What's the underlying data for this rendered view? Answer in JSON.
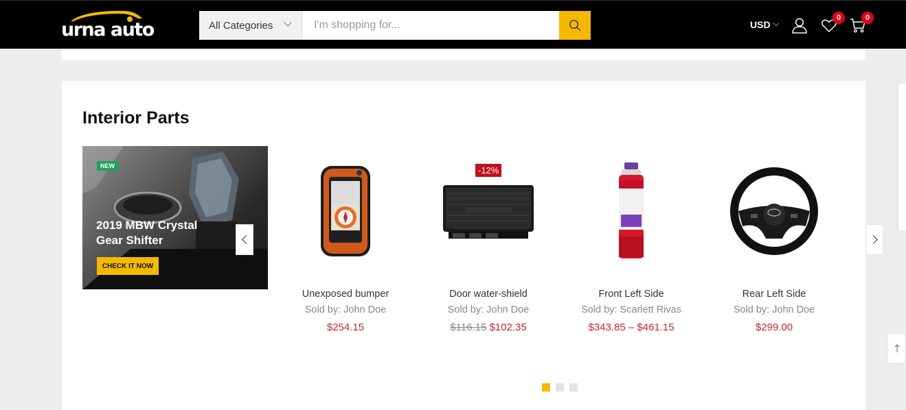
{
  "header": {
    "logo_text": "urna auto",
    "category_select": "All Categories",
    "search_placeholder": "I'm shopping for...",
    "currency": "USD",
    "wishlist_count": "0",
    "cart_count": "0"
  },
  "section": {
    "title": "Interior Parts"
  },
  "banner": {
    "badge": "NEW",
    "title": "2019 MBW Crystal Gear Shifter",
    "button": "CHECK IT NOW"
  },
  "products": [
    {
      "name": "Unexposed bumper",
      "seller": "Sold by: John Doe",
      "price": "$254.15",
      "icon": "gps-device"
    },
    {
      "name": "Door water-shield",
      "seller": "Sold by: John Doe",
      "old_price": "$116.15",
      "price": "$102.35",
      "sale": "-12%",
      "icon": "car-amplifier"
    },
    {
      "name": "Front Left Side",
      "seller": "Sold by: Scarlett Rivas",
      "price": "$343.85 – $461.15",
      "icon": "spray-can"
    },
    {
      "name": "Rear Left Side",
      "seller": "Sold by: John Doe",
      "price": "$299.00",
      "icon": "steering-wheel-cover"
    }
  ],
  "colors": {
    "accent": "#f5b800",
    "price": "#c1272d",
    "badge": "#e3001b",
    "new": "#1aa35a"
  }
}
